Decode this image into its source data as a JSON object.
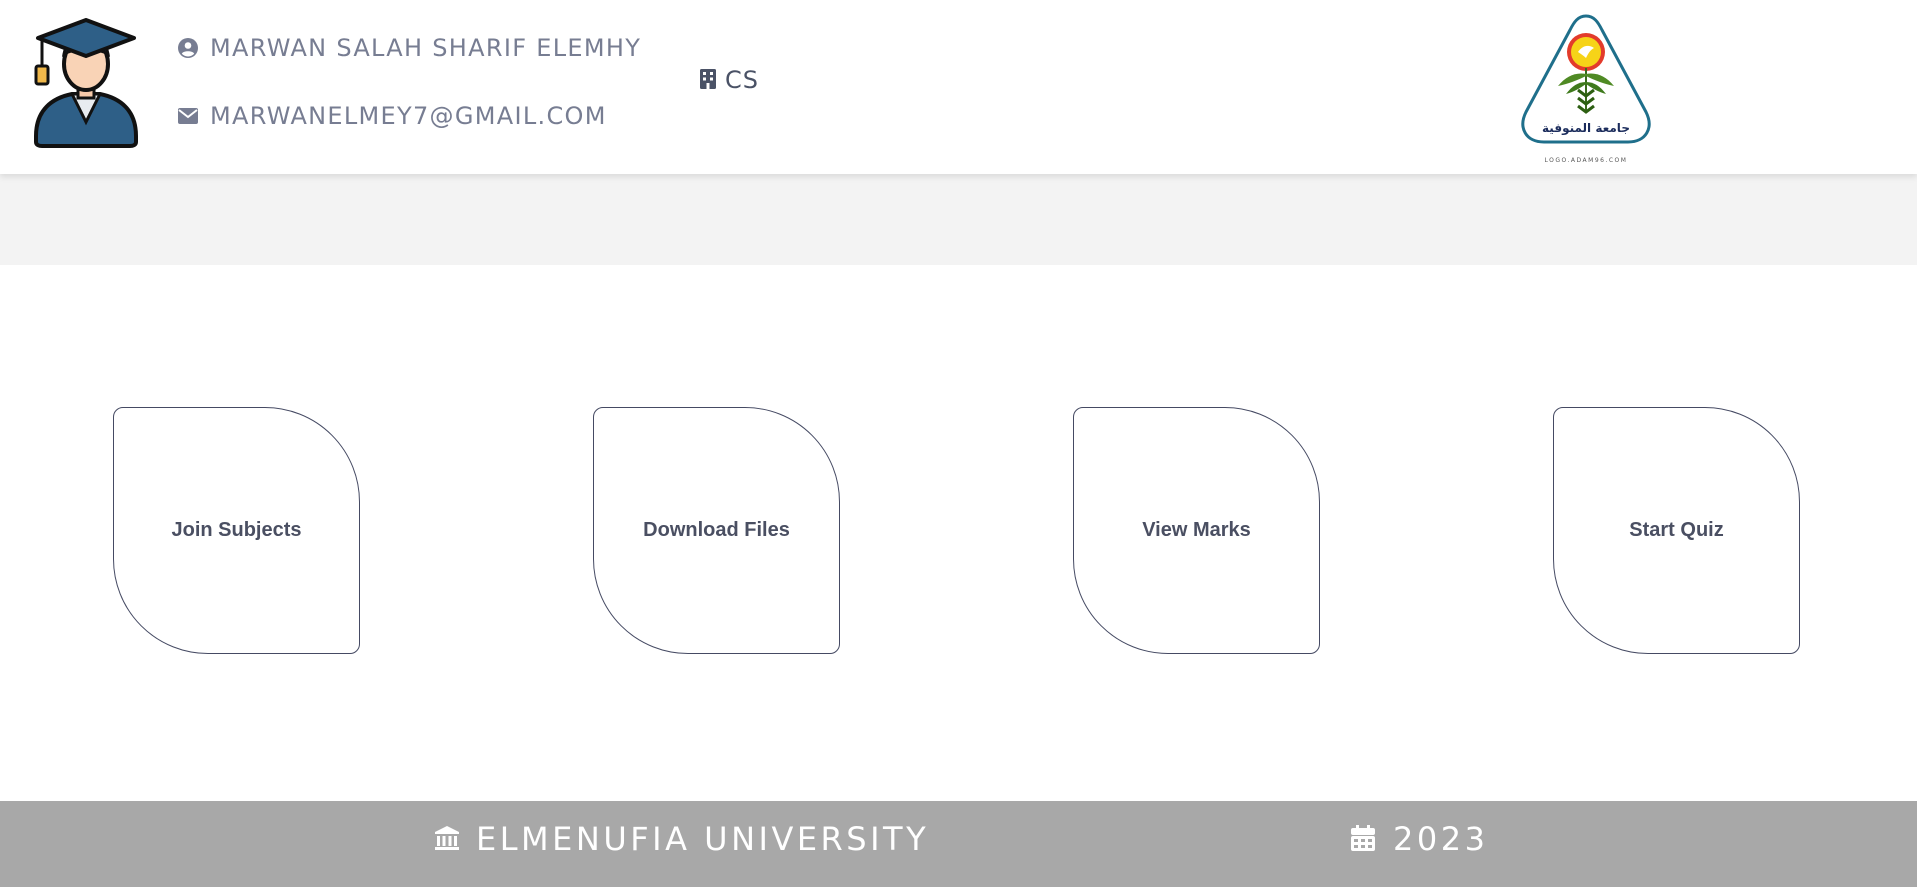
{
  "header": {
    "student_name": "MARWAN SALAH SHARIF ELEMHY",
    "email": "MARWANELMEY7@GMAIL.COM",
    "department": "CS",
    "logo_arabic": "جامعة المنوفية",
    "logo_caption": "LOGO.ADAM96.COM"
  },
  "actions": [
    {
      "label": "Join Subjects"
    },
    {
      "label": "Download Files"
    },
    {
      "label": "View Marks"
    },
    {
      "label": "Start Quiz"
    }
  ],
  "footer": {
    "university": "ELMENUFIA UNIVERSITY",
    "year": "2023"
  },
  "icons": {
    "name": "user-circle-icon",
    "email": "envelope-icon",
    "department": "building-icon",
    "university": "university-icon",
    "year": "calendar-icon"
  },
  "colors": {
    "card_border": "#454a63",
    "footer_bg": "#a8a8a8",
    "band_bg": "#f3f3f3",
    "header_text": "#777d92"
  }
}
